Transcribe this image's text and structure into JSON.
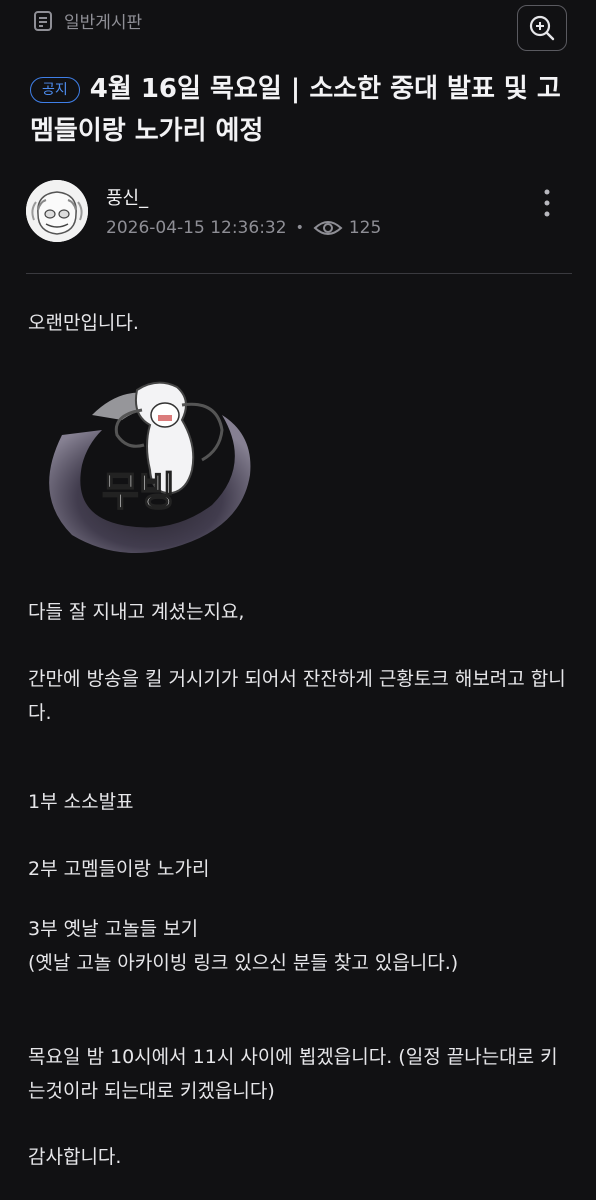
{
  "board": {
    "name": "일반게시판",
    "icon": "document-icon"
  },
  "toolbar": {
    "zoom_icon": "zoom-in-icon"
  },
  "post": {
    "badge": "공지",
    "title": "4월 16일 목요일 | 소소한 중대 발표 및 고멤들이랑 노가리 예정",
    "author": "풍신_",
    "datetime": "2026-04-15 12:36:32",
    "separator": "•",
    "views": "125",
    "more_icon": "more-vertical-icon"
  },
  "content": {
    "greeting": "오랜만입니다.",
    "sticker_text": "무빙",
    "p1": "다들 잘 지내고 계셨는지요,",
    "p2": "간만에 방송을 킬 거시기가 되어서 잔잔하게 근황토크 해보려고 합니다.",
    "part1": "1부 소소발표",
    "part2": "2부 고멤들이랑 노가리",
    "part3": "3부 옛날 고놀들 보기",
    "part3_note": "(옛날 고놀 아카이빙 링크 있으신 분들 찾고 있읍니다.)",
    "schedule": "목요일 밤 10시에서 11시 사이에 뵙겠읍니다. (일정 끝나는대로 키는것이라 되는대로 키겠읍니다)",
    "thanks": "감사합니다."
  },
  "colors": {
    "accent": "#3f7fe8",
    "background": "#111113",
    "text": "#e9e9ec",
    "muted": "#8e8e95"
  }
}
